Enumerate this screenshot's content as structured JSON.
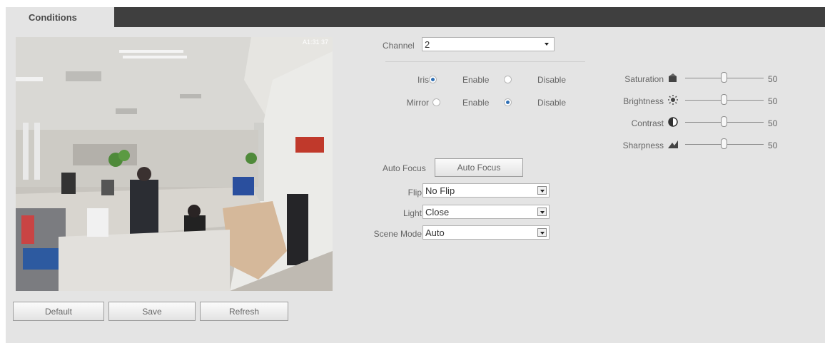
{
  "tab": {
    "label": "Conditions"
  },
  "preview": {
    "osd": "A1:31 37"
  },
  "buttons": {
    "default": "Default",
    "save": "Save",
    "refresh": "Refresh",
    "auto_focus": "Auto Focus"
  },
  "channel": {
    "label": "Channel",
    "value": "2"
  },
  "iris": {
    "label": "Iris",
    "enable": "Enable",
    "disable": "Disable",
    "selected": "Enable"
  },
  "mirror": {
    "label": "Mirror",
    "enable": "Enable",
    "disable": "Disable",
    "selected": "Disable"
  },
  "auto_focus": {
    "label": "Auto Focus"
  },
  "flip": {
    "label": "Flip",
    "value": "No Flip"
  },
  "light": {
    "label": "Light",
    "value": "Close"
  },
  "scene_mode": {
    "label": "Scene Mode",
    "value": "Auto"
  },
  "sliders": {
    "saturation": {
      "label": "Saturation",
      "value": "50",
      "icon": "saturation-icon"
    },
    "brightness": {
      "label": "Brightness",
      "value": "50",
      "icon": "brightness-icon"
    },
    "contrast": {
      "label": "Contrast",
      "value": "50",
      "icon": "contrast-icon"
    },
    "sharpness": {
      "label": "Sharpness",
      "value": "50",
      "icon": "sharpness-icon"
    }
  },
  "colors": {
    "tab_bar": "#3f3f3f",
    "panel": "#e4e4e4",
    "radio_selected": "#2f6fb4"
  }
}
